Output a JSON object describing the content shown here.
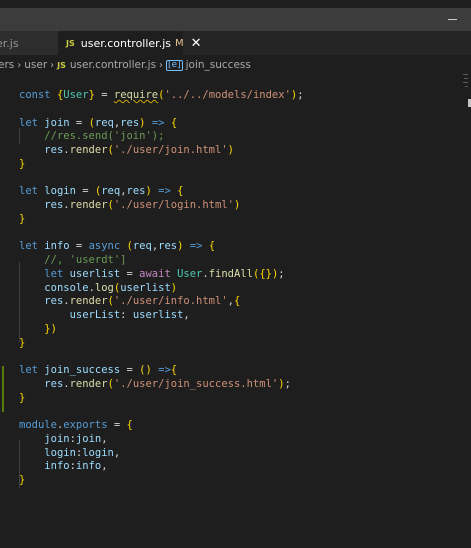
{
  "tabs": [
    {
      "label": "er.js",
      "active": false
    },
    {
      "label": "user.controller.js",
      "active": true,
      "status": "M",
      "icon": "JS"
    }
  ],
  "breadcrumb": {
    "items": [
      "ers",
      "user",
      "user.controller.js",
      "join_success"
    ],
    "file_icon": "JS",
    "symbol_icon": "[e]"
  },
  "code_lines": [
    "const {User} = require('../../models/index');",
    "",
    "let join = (req,res) => {",
    "    //res.send('join');",
    "    res.render('./user/join.html')",
    "}",
    "",
    "let login = (req,res) => {",
    "    res.render('./user/login.html')",
    "}",
    "",
    "let info = async (req,res) => {",
    "    //, 'userdt']",
    "    let userlist = await User.findAll({});",
    "    console.log(userlist)",
    "    res.render('./user/info.html',{",
    "        userList: userlist,",
    "    })",
    "}",
    "",
    "let join_success = () =>{",
    "    res.render('./user/join_success.html');",
    "}",
    "",
    "module.exports = {",
    "    join:join,",
    "    login:login,",
    "    info:info,",
    "}"
  ],
  "colors": {
    "keyword": "#569cd6",
    "variable": "#9cdcfe",
    "function": "#dcdcaa",
    "class": "#4ec9b0",
    "string": "#ce9178",
    "comment": "#6a9955",
    "control": "#c586c0",
    "modified_gutter": "#587c0c",
    "editor_bg": "#1e1e1e"
  }
}
